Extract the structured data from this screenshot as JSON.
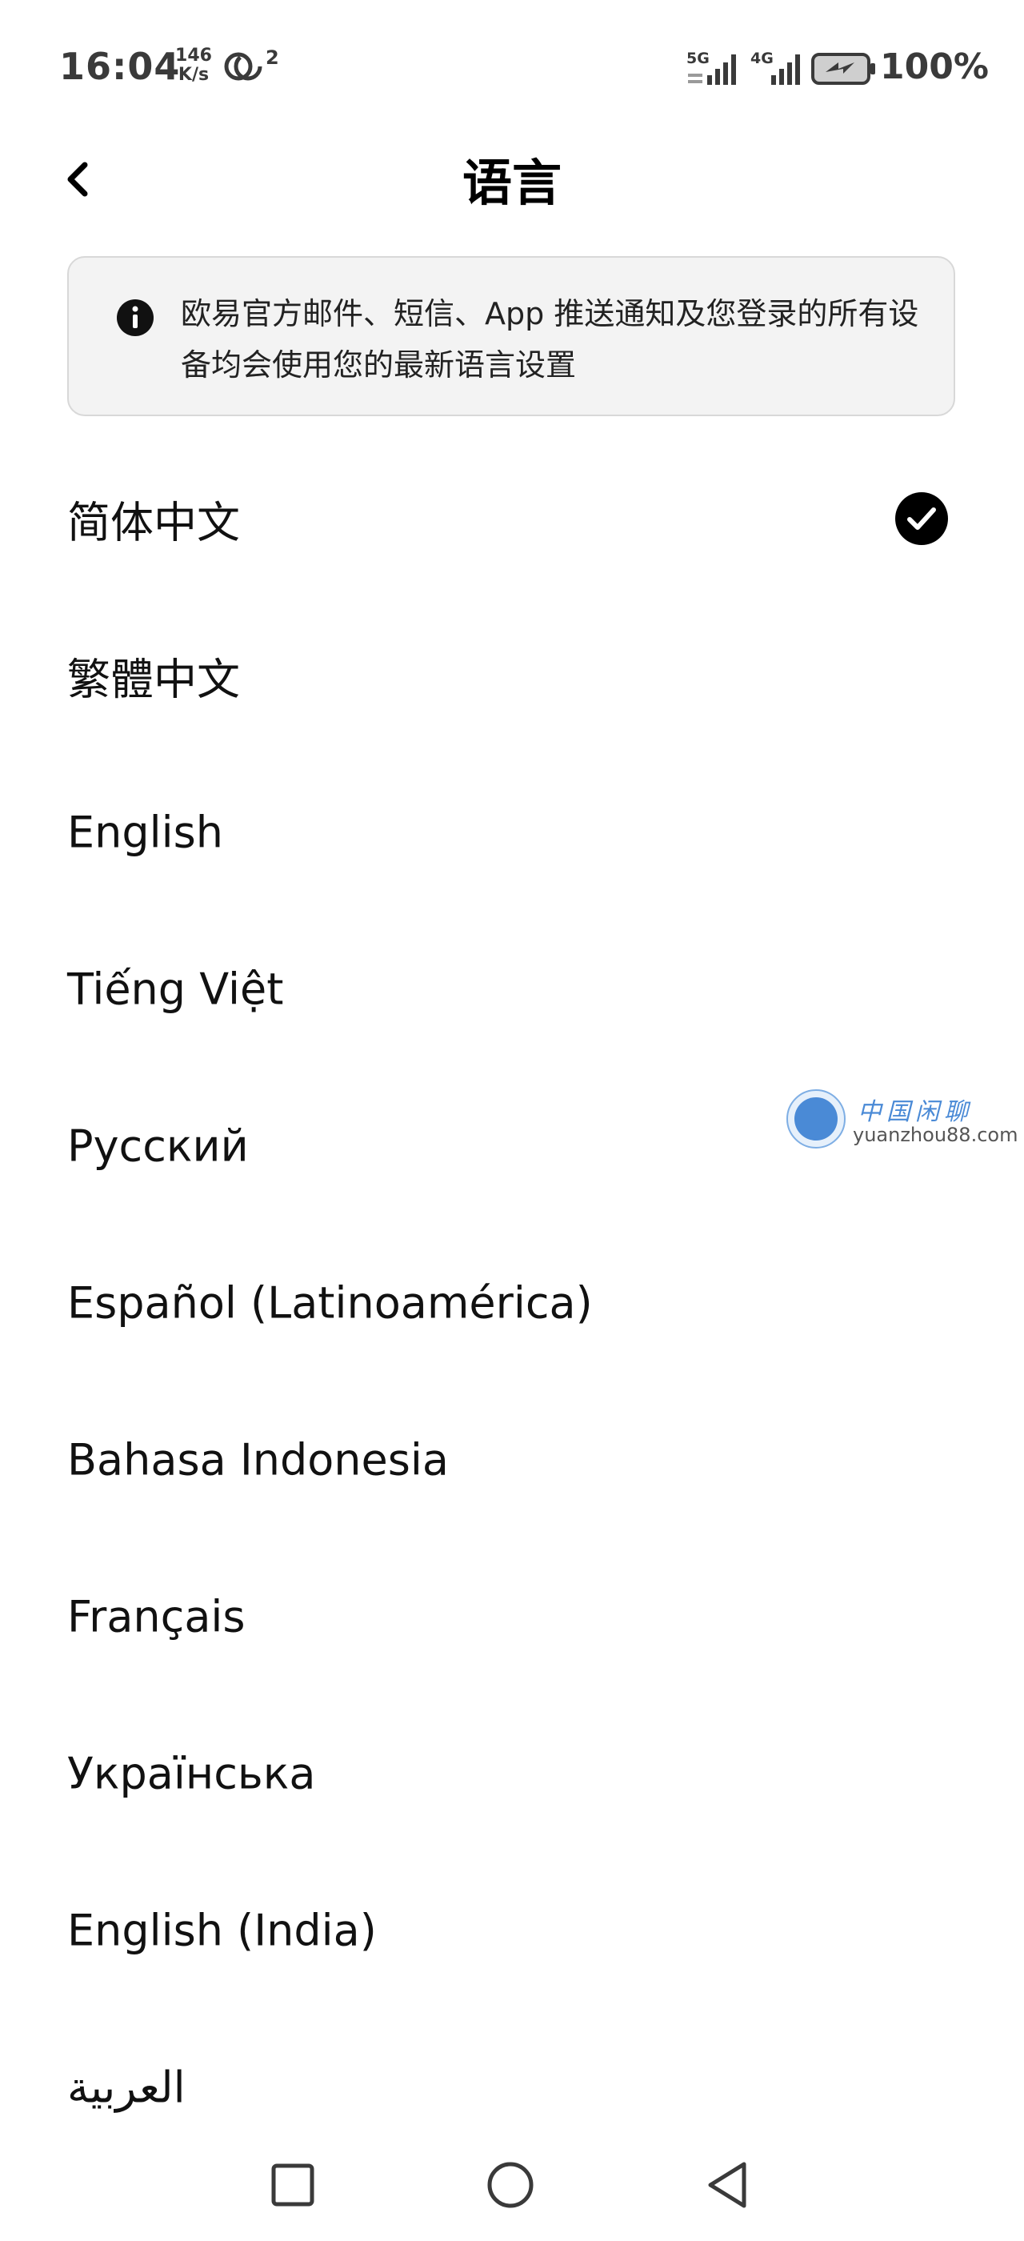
{
  "status_bar": {
    "time": "16:04",
    "net_speed_value": "146",
    "net_speed_unit": "K/s",
    "hotspot_count": "2",
    "signal_1_label": "5G",
    "signal_2_label": "4G",
    "battery": "100%",
    "icons": [
      "hotspot-icon",
      "signal-icon",
      "battery-charging-icon"
    ]
  },
  "header": {
    "title": "语言",
    "back_icon": "chevron-left-icon"
  },
  "notice": {
    "icon": "info-icon",
    "text": "欧易官方邮件、短信、App 推送通知及您登录的所有设备均会使用您的最新语言设置"
  },
  "languages": [
    {
      "label": "简体中文",
      "selected": true
    },
    {
      "label": "繁體中文",
      "selected": false
    },
    {
      "label": "English",
      "selected": false
    },
    {
      "label": "Tiếng Việt",
      "selected": false
    },
    {
      "label": "Русский",
      "selected": false
    },
    {
      "label": "Español (Latinoamérica)",
      "selected": false
    },
    {
      "label": "Bahasa Indonesia",
      "selected": false
    },
    {
      "label": "Français",
      "selected": false
    },
    {
      "label": "Українська",
      "selected": false
    },
    {
      "label": "English (India)",
      "selected": false
    },
    {
      "label": "العربية",
      "selected": false
    }
  ],
  "watermark": {
    "name": "中国闲聊",
    "url": "yuanzhou88.com"
  },
  "nav_bar": {
    "icons": [
      "recents-square-icon",
      "home-circle-icon",
      "back-triangle-icon"
    ]
  },
  "colors": {
    "text": "#111111",
    "notice_bg": "#f3f3f3",
    "notice_border": "#d8d8d8",
    "check": "#000000",
    "watermark": "#4a8ad6"
  }
}
